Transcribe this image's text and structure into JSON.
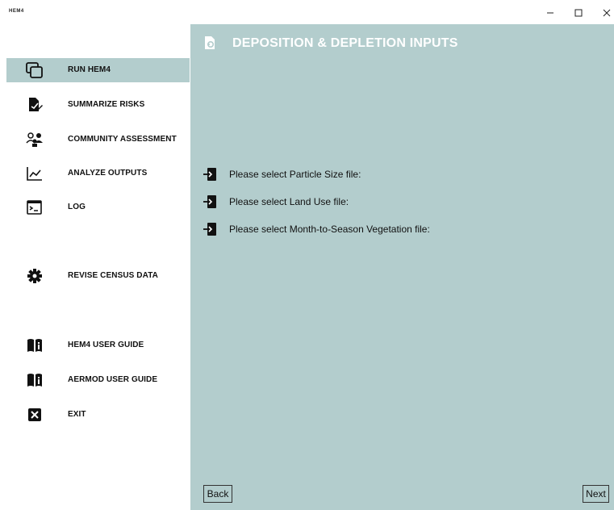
{
  "window": {
    "title": "HEM4",
    "controls": [
      "minimize",
      "maximize",
      "close"
    ]
  },
  "sidebar": {
    "items": [
      {
        "label": "RUN HEM4",
        "icon": "run-window-icon",
        "active": true
      },
      {
        "label": "SUMMARIZE RISKS",
        "icon": "document-edit-icon",
        "active": false
      },
      {
        "label": "COMMUNITY ASSESSMENT",
        "icon": "community-people-icon",
        "active": false
      },
      {
        "label": "ANALYZE OUTPUTS",
        "icon": "line-chart-icon",
        "active": false
      },
      {
        "label": "LOG",
        "icon": "terminal-icon",
        "active": false
      },
      {
        "label": "REVISE CENSUS DATA",
        "icon": "gear-icon",
        "active": false
      },
      {
        "label": "HEM4 USER GUIDE",
        "icon": "book-info-icon",
        "active": false
      },
      {
        "label": "AERMOD USER GUIDE",
        "icon": "book-info-icon",
        "active": false
      },
      {
        "label": "EXIT",
        "icon": "close-box-icon",
        "active": false
      }
    ]
  },
  "main": {
    "title": "DEPOSITION & DEPLETION INPUTS",
    "title_icon": "inputs-icon",
    "file_inputs": [
      {
        "label": "Please select Particle Size file:",
        "icon": "file-select-icon"
      },
      {
        "label": "Please select Land Use file:",
        "icon": "file-select-icon"
      },
      {
        "label": "Please select Month-to-Season Vegetation file:",
        "icon": "file-select-icon"
      }
    ],
    "back_label": "Back",
    "next_label": "Next"
  },
  "colors": {
    "panel": "#b3cdcd",
    "sidebar": "#ffffff",
    "header_text": "#ffffff"
  }
}
